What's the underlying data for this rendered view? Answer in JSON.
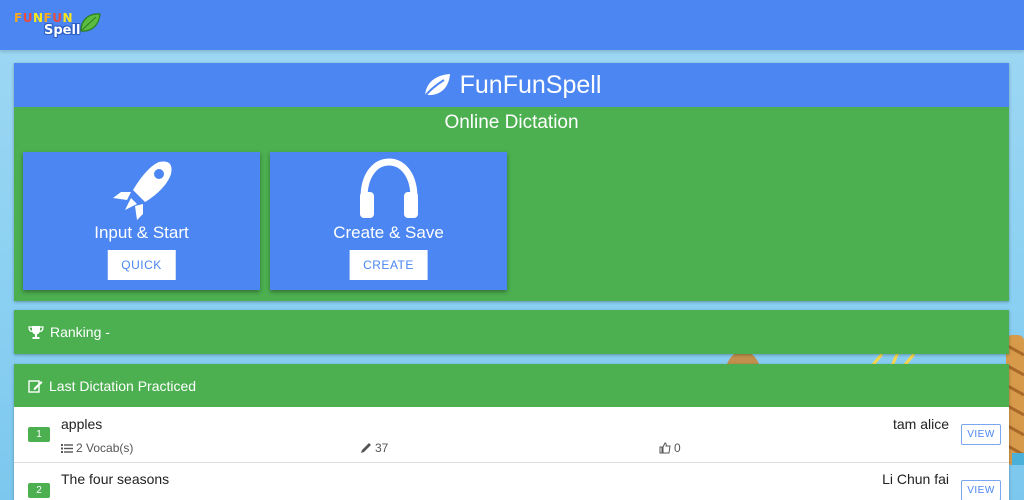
{
  "header": {
    "logo_top": "FUNFUN",
    "logo_bottom": "Spell"
  },
  "dictation": {
    "title": "FunFunSpell",
    "subtitle": "Online Dictation",
    "cards": [
      {
        "title": "Input & Start",
        "button": "QUICK",
        "icon": "rocket-icon"
      },
      {
        "title": "Create & Save",
        "button": "CREATE",
        "icon": "headphones-icon"
      }
    ]
  },
  "ranking": {
    "label": "Ranking -",
    "icon": "trophy-icon"
  },
  "last_practiced": {
    "label": "Last Dictation Practiced",
    "icon": "edit-icon",
    "rows": [
      {
        "rank": "1",
        "name": "apples",
        "author": "tam alice",
        "vocab": "2 Vocab(s)",
        "edits": "37",
        "likes": "0",
        "button": "VIEW"
      },
      {
        "rank": "2",
        "name": "The four seasons",
        "author": "Li Chun fai",
        "vocab": "",
        "edits": "",
        "likes": "",
        "button": "VIEW"
      }
    ]
  },
  "colors": {
    "primary_blue": "#4b86f2",
    "green": "#4caf50",
    "background": "#8ad0f2"
  }
}
